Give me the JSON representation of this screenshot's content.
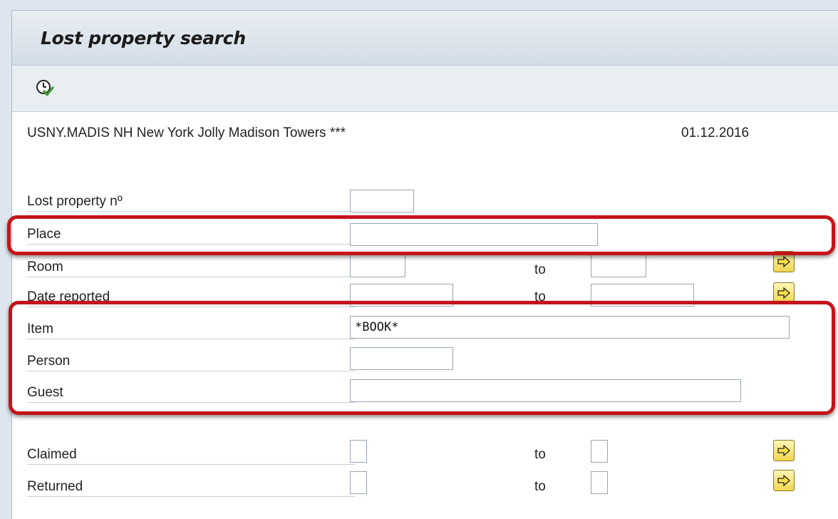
{
  "window": {
    "title": "Lost property search"
  },
  "toolbar": {
    "execute_icon": "execute-clock-icon"
  },
  "header": {
    "hotel": "USNY.MADIS NH New York Jolly Madison Towers ***",
    "date": "01.12.2016"
  },
  "fields": {
    "lost_property_no": {
      "label": "Lost property nº",
      "value": ""
    },
    "place": {
      "label": "Place",
      "value": ""
    },
    "room": {
      "label": "Room",
      "from": "",
      "to_label": "to",
      "to": ""
    },
    "date_reported": {
      "label": "Date reported",
      "from": "",
      "to_label": "to",
      "to": ""
    },
    "item": {
      "label": "Item",
      "value": "*BOOK*"
    },
    "person": {
      "label": "Person",
      "value": ""
    },
    "guest": {
      "label": "Guest",
      "value": ""
    },
    "claimed": {
      "label": "Claimed",
      "from": "",
      "to_label": "to",
      "to": ""
    },
    "returned": {
      "label": "Returned",
      "from": "",
      "to_label": "to",
      "to": ""
    }
  },
  "multiple_selection_icon": "arrow-right-icon",
  "highlight_color": "#c4141a"
}
